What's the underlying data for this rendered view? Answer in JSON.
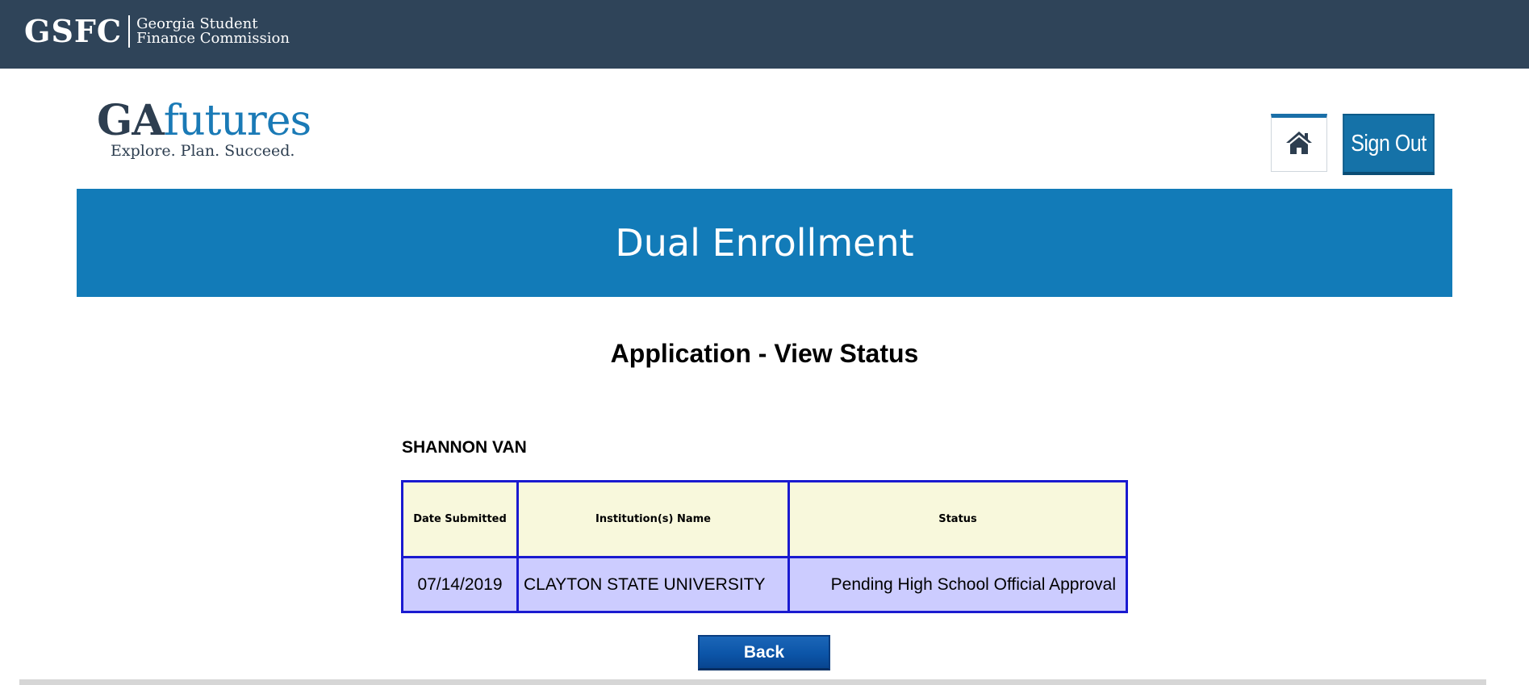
{
  "topbar": {
    "abbr": "GSFC",
    "name_line1": "Georgia Student",
    "name_line2": "Finance Commission"
  },
  "header": {
    "logo_ga": "GA",
    "logo_futures": "futures",
    "tagline": "Explore. Plan. Succeed.",
    "home_icon": "home-icon",
    "signout_label": "Sign Out"
  },
  "banner": {
    "title": "Dual Enrollment"
  },
  "main": {
    "heading": "Application - View Status",
    "student_name": "SHANNON VAN",
    "table": {
      "columns": [
        "Date Submitted",
        "Institution(s) Name",
        "Status"
      ],
      "rows": [
        [
          "07/14/2019",
          "CLAYTON STATE UNIVERSITY",
          "Pending High School Official Approval"
        ]
      ]
    },
    "back_label": "Back"
  },
  "colors": {
    "topbar": "#2f4459",
    "banner": "#127bb8",
    "table_border": "#1a1ad0",
    "header_cell": "#f8f8dc",
    "data_cell": "#ccccff"
  }
}
